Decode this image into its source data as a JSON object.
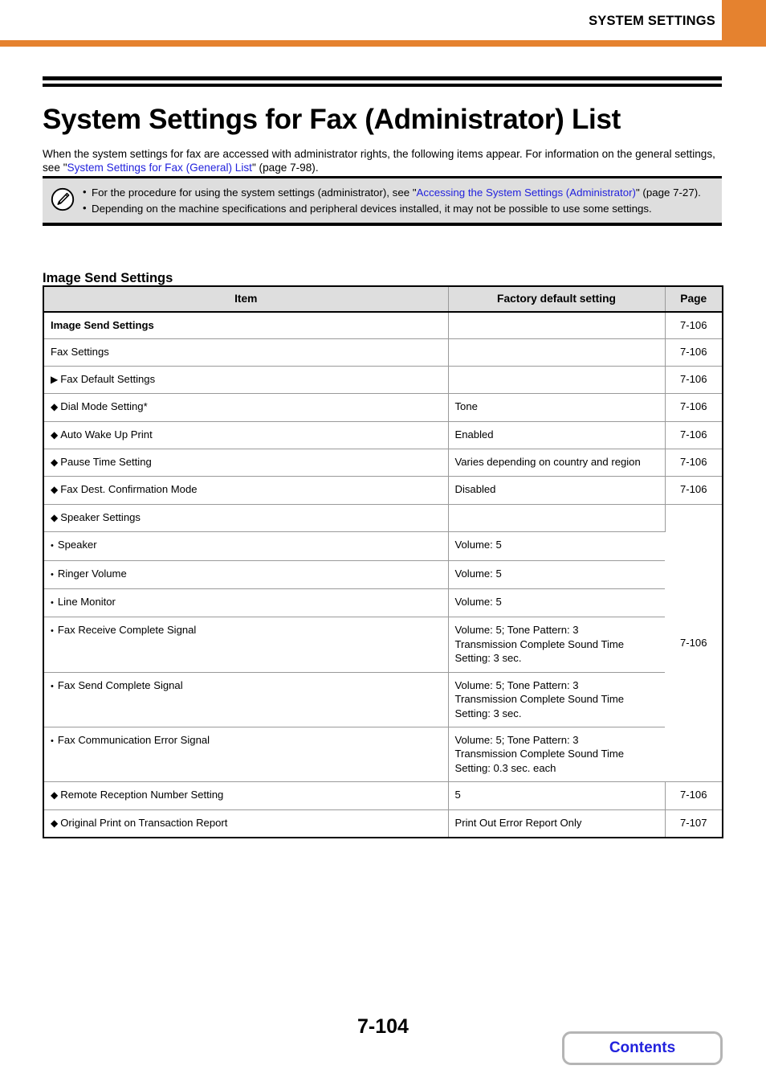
{
  "header": {
    "title": "SYSTEM SETTINGS",
    "tab_color": "#e5822f",
    "rule_color": "#e5822f"
  },
  "title": "System Settings for Fax (Administrator) List",
  "intro": {
    "before_link": "When the system settings for fax are accessed with administrator rights, the following items appear. For information on the general settings, see \"",
    "link_text": "System Settings for Fax (General) List",
    "after_link": "\" (page 7-98)."
  },
  "note": {
    "icon": "pencil-note-icon",
    "items": [
      {
        "bullet": "•",
        "before_link": "For the procedure for using the system settings (administrator), see \"",
        "link_text": "Accessing the System Settings (Administrator)",
        "after_link": "\" (page 7-27)."
      },
      {
        "bullet": "•",
        "before_link": "Depending on the machine specifications and peripheral devices installed, it may not be possible to use some settings.",
        "link_text": "",
        "after_link": ""
      }
    ]
  },
  "section_heading": "Image Send Settings",
  "table": {
    "columns": [
      "Item",
      "Factory default setting",
      "Page"
    ],
    "rows": [
      {
        "level": 1,
        "marker": "",
        "item": "Image Send Settings",
        "default": "",
        "page": "7-106"
      },
      {
        "level": 2,
        "marker": "",
        "item": "Fax Settings",
        "default": "",
        "page": "7-106"
      },
      {
        "level": 3,
        "marker": "▶",
        "item": "Fax Default Settings",
        "default": "",
        "page": "7-106"
      },
      {
        "level": 4,
        "marker": "◆",
        "item": "Dial Mode Setting*",
        "default": "Tone",
        "page": "7-106"
      },
      {
        "level": 4,
        "marker": "◆",
        "item": "Auto Wake Up Print",
        "default": "Enabled",
        "page": "7-106"
      },
      {
        "level": 4,
        "marker": "◆",
        "item": "Pause Time Setting",
        "default": "Varies depending on country and region",
        "page": "7-106"
      },
      {
        "level": 4,
        "marker": "◆",
        "item": "Fax Dest. Confirmation Mode",
        "default": "Disabled",
        "page": "7-106"
      },
      {
        "level": 4,
        "marker": "◆",
        "item": "Speaker Settings",
        "default": "",
        "page": "7-106",
        "page_rowspan": 7
      },
      {
        "level": 5,
        "marker": "•",
        "item": "Speaker",
        "default": "Volume: 5",
        "page": null
      },
      {
        "level": 5,
        "marker": "•",
        "item": "Ringer Volume",
        "default": "Volume: 5",
        "page": null
      },
      {
        "level": 5,
        "marker": "•",
        "item": "Line Monitor",
        "default": "Volume: 5",
        "page": null
      },
      {
        "level": 5,
        "marker": "•",
        "item": "Fax Receive Complete Signal",
        "default": "Volume: 5; Tone Pattern: 3\nTransmission Complete Sound Time\nSetting: 3 sec.",
        "page": null
      },
      {
        "level": 5,
        "marker": "•",
        "item": "Fax Send Complete Signal",
        "default": "Volume: 5; Tone Pattern: 3\nTransmission Complete Sound Time\nSetting: 3 sec.",
        "page": null
      },
      {
        "level": 5,
        "marker": "•",
        "item": "Fax Communication Error Signal",
        "default": "Volume: 5; Tone Pattern: 3\nTransmission Complete Sound Time\nSetting: 0.3 sec. each",
        "page": null
      },
      {
        "level": 4,
        "marker": "◆",
        "item": "Remote Reception Number Setting",
        "default": "5",
        "page": "7-106"
      },
      {
        "level": 4,
        "marker": "◆",
        "item": "Original Print on Transaction Report",
        "default": "Print Out Error Report Only",
        "page": "7-107"
      }
    ]
  },
  "footer": {
    "page_number": "7-104",
    "contents_label": "Contents"
  },
  "colors": {
    "link": "#2222dd",
    "accent": "#e5822f",
    "header_fill": "#dedede",
    "note_fill": "#dedede"
  }
}
